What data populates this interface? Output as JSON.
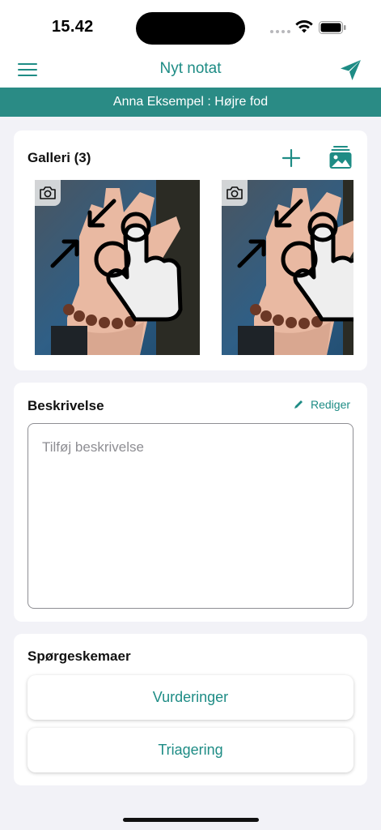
{
  "status_bar": {
    "time": "15.42",
    "icons": [
      "signal-dots-icon",
      "wifi-icon",
      "battery-icon"
    ]
  },
  "nav": {
    "title": "Nyt notat",
    "left_icon": "hamburger-menu-icon",
    "right_icon": "send-icon"
  },
  "banner": {
    "text": "Anna Eksempel : Højre fod"
  },
  "gallery": {
    "title": "Galleri (3)",
    "add_icon": "plus-icon",
    "library_icon": "photo-library-icon",
    "photos": [
      {
        "badge_icon": "camera-icon",
        "content": "hand-with-pinch-gesture-photo"
      },
      {
        "badge_icon": "camera-icon",
        "content": "hand-with-pinch-gesture-photo"
      }
    ]
  },
  "description": {
    "title": "Beskrivelse",
    "edit_label": "Rediger",
    "edit_icon": "pencil-icon",
    "placeholder": "Tilføj beskrivelse"
  },
  "questionnaires": {
    "title": "Spørgeskemaer",
    "buttons": [
      "Vurderinger",
      "Triagering"
    ]
  },
  "colors": {
    "accent": "#1e8c85",
    "banner": "#2a8b85",
    "background": "#f2f2f7",
    "card": "#ffffff",
    "placeholder": "#8e8e93"
  }
}
